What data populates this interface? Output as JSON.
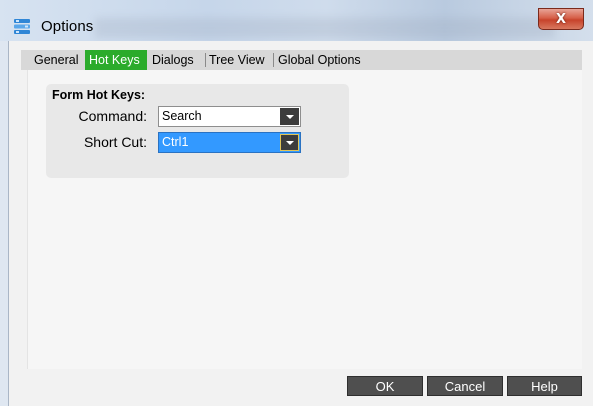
{
  "window": {
    "title": "Options",
    "close_glyph": "X",
    "icon": "options-app-icon"
  },
  "tabs": [
    {
      "label": "General",
      "active": false
    },
    {
      "label": "Hot Keys",
      "active": true
    },
    {
      "label": "Dialogs",
      "active": false
    },
    {
      "label": "Tree View",
      "active": false
    },
    {
      "label": "Global Options",
      "active": false
    }
  ],
  "hotkeys": {
    "group_title": "Form Hot Keys:",
    "command_label": "Command:",
    "command_value": "Search",
    "shortcut_label": "Short Cut:",
    "shortcut_value": "Ctrl1"
  },
  "buttons": {
    "ok": "OK",
    "cancel": "Cancel",
    "help": "Help"
  },
  "colors": {
    "active_tab": "#2bab2b",
    "selection": "#3399ff",
    "button_bg": "#4f4f4f",
    "close_button": "#c7432b"
  }
}
